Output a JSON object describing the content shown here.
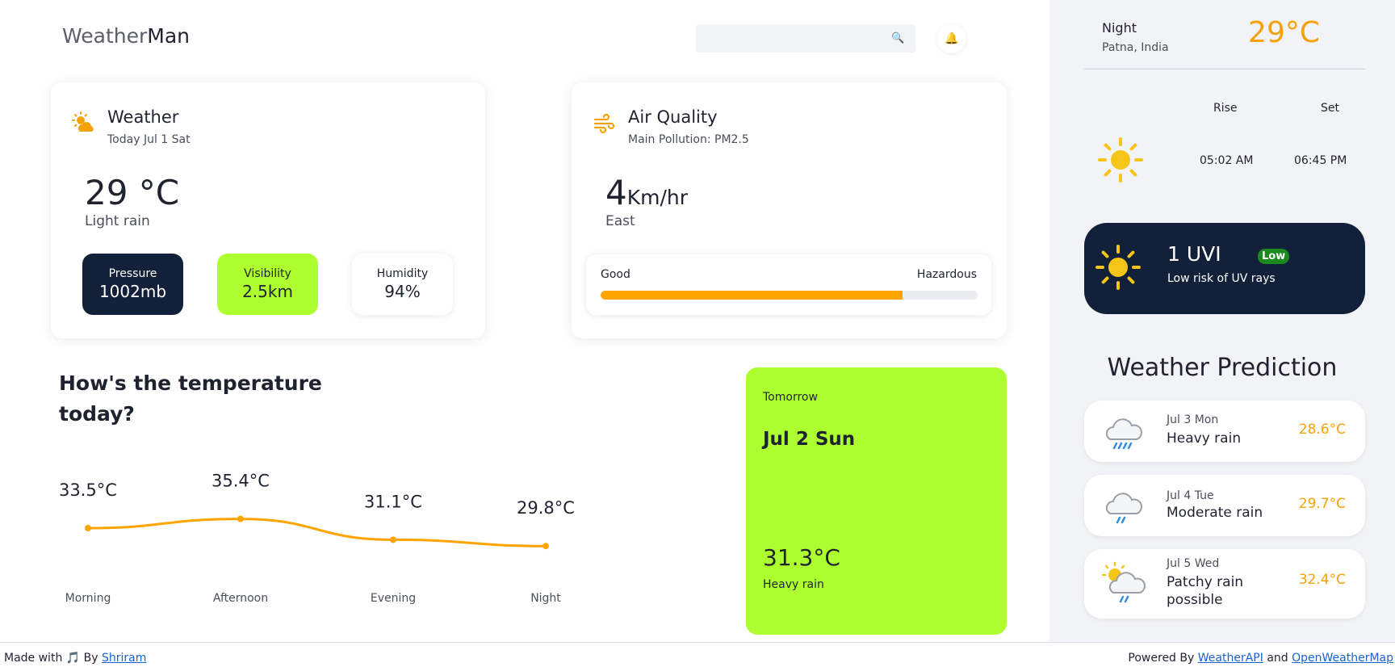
{
  "header": {
    "logo_light": "Weather",
    "logo_bold": "Man",
    "search_placeholder": "",
    "search_icon": "magnifier-icon",
    "bell_icon": "bell-icon"
  },
  "weather_card": {
    "title": "Weather",
    "subtitle": "Today Jul 1 Sat",
    "temperature": "29 °C",
    "condition": "Light rain",
    "stats": [
      {
        "label": "Pressure",
        "value": "1002mb"
      },
      {
        "label": "Visibility",
        "value": "2.5km"
      },
      {
        "label": "Humidity",
        "value": "94%"
      }
    ]
  },
  "air_quality_card": {
    "title": "Air Quality",
    "subtitle": "Main Pollution: PM2.5",
    "wind_speed": "4",
    "wind_unit": "Km/hr",
    "wind_direction": "East",
    "scale_low": "Good",
    "scale_high": "Hazardous",
    "level_fraction": 0.8
  },
  "temperature_section": {
    "title": "How's the temperature today?"
  },
  "chart_data": {
    "type": "line",
    "categories": [
      "Morning",
      "Afternoon",
      "Evening",
      "Night"
    ],
    "values": [
      33.5,
      35.4,
      31.1,
      29.8
    ],
    "labels": [
      "33.5°C",
      "35.4°C",
      "31.1°C",
      "29.8°C"
    ],
    "color": "#ffa500"
  },
  "tomorrow_card": {
    "label": "Tomorrow",
    "date": "Jul 2 Sun",
    "temperature": "31.3°C",
    "condition": "Heavy rain"
  },
  "side_panel": {
    "period": "Night",
    "location": "Patna, India",
    "temperature": "29°C",
    "rise_label": "Rise",
    "set_label": "Set",
    "rise_time": "05:02 AM",
    "set_time": "06:45 PM",
    "uv": {
      "value": "1 UVI",
      "badge": "Low",
      "description": "Low risk of UV rays"
    },
    "prediction_title": "Weather Prediction",
    "predictions": [
      {
        "date": "Jul 3 Mon",
        "condition": "Heavy rain",
        "temp": "28.6°C",
        "icon": "heavy-rain-icon"
      },
      {
        "date": "Jul 4 Tue",
        "condition": "Moderate rain",
        "temp": "29.7°C",
        "icon": "moderate-rain-icon"
      },
      {
        "date": "Jul 5 Wed",
        "condition": "Patchy rain possible",
        "temp": "32.4°C",
        "icon": "patchy-rain-icon"
      }
    ]
  },
  "footer": {
    "made_with": "Made with",
    "music_icon": "🎵",
    "by": "By",
    "author": "Shriram",
    "powered_by": "Powered By",
    "api1": "WeatherAPI",
    "and": "and",
    "api2": "OpenWeatherMap"
  },
  "colors": {
    "accent": "#f5a10a",
    "lime": "#adff2f",
    "navy": "#12203a"
  }
}
